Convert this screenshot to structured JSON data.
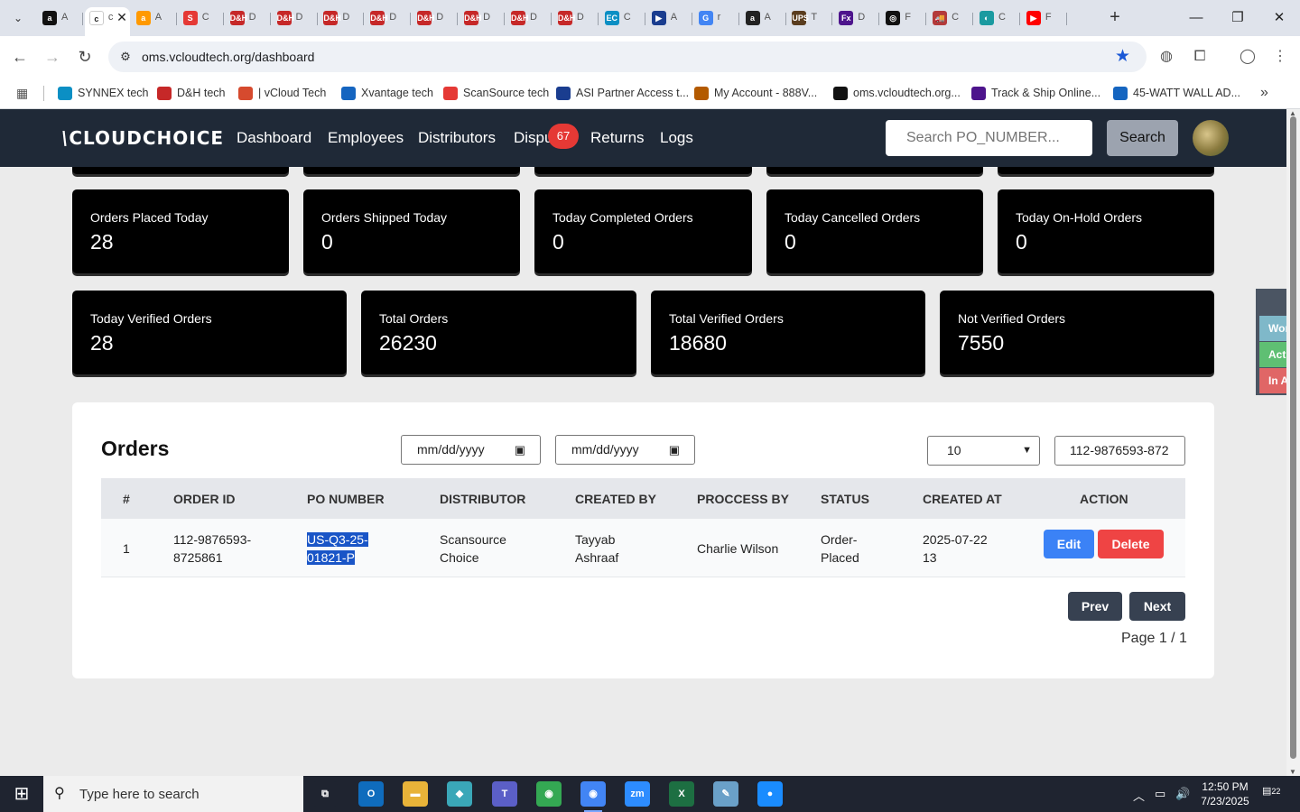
{
  "browser": {
    "tabs": [
      {
        "icon": "amazon-icon",
        "label": "A",
        "glyph": "a",
        "color": "#111111"
      },
      {
        "icon": "cloudchoice-icon",
        "label": "c",
        "glyph": "c",
        "color": "#ffffff",
        "active": true
      },
      {
        "icon": "amazon-icon",
        "label": "A",
        "glyph": "a",
        "color": "#ff9900"
      },
      {
        "icon": "scansource-icon",
        "label": "C",
        "glyph": "S",
        "color": "#e53935"
      },
      {
        "icon": "dh-icon",
        "label": "D",
        "glyph": "D&H",
        "color": "#c62828"
      },
      {
        "icon": "dh-icon",
        "label": "D",
        "glyph": "D&H",
        "color": "#c62828"
      },
      {
        "icon": "dh-icon",
        "label": "D",
        "glyph": "D&H",
        "color": "#c62828"
      },
      {
        "icon": "dh-icon",
        "label": "D",
        "glyph": "D&H",
        "color": "#c62828"
      },
      {
        "icon": "dh-icon",
        "label": "D",
        "glyph": "D&H",
        "color": "#c62828"
      },
      {
        "icon": "dh-icon",
        "label": "D",
        "glyph": "D&H",
        "color": "#c62828"
      },
      {
        "icon": "dh-icon",
        "label": "D",
        "glyph": "D&H",
        "color": "#c62828"
      },
      {
        "icon": "dh-icon",
        "label": "D",
        "glyph": "D&H",
        "color": "#c62828"
      },
      {
        "icon": "ec-icon",
        "label": "C",
        "glyph": "EC",
        "color": "#0b8fc4"
      },
      {
        "icon": "asi-icon",
        "label": "A",
        "glyph": "▶",
        "color": "#1a3d8f"
      },
      {
        "icon": "google-icon",
        "label": "r",
        "glyph": "G",
        "color": "#4285f4"
      },
      {
        "icon": "amazon-icon",
        "label": "A",
        "glyph": "a",
        "color": "#222222"
      },
      {
        "icon": "ups-icon",
        "label": "T",
        "glyph": "UPS",
        "color": "#5a3d1e"
      },
      {
        "icon": "fedex-icon",
        "label": "D",
        "glyph": "Fx",
        "color": "#4d148c"
      },
      {
        "icon": "openai-icon",
        "label": "F",
        "glyph": "◎",
        "color": "#111111"
      },
      {
        "icon": "truck-icon",
        "label": "C",
        "glyph": "🚚",
        "color": "#b33a3a"
      },
      {
        "icon": "edge-icon",
        "label": "C",
        "glyph": "◐",
        "color": "#1a9aa0"
      },
      {
        "icon": "youtube-icon",
        "label": "F",
        "glyph": "▶",
        "color": "#ff0000"
      }
    ],
    "url": "oms.vcloudtech.org/dashboard",
    "bookmarks": [
      {
        "icon": "ec-icon",
        "label": "SYNNEX tech",
        "color": "#0b8fc4"
      },
      {
        "icon": "dh-icon",
        "label": "D&H tech",
        "color": "#c62828"
      },
      {
        "icon": "vcloud-icon",
        "label": "| vCloud Tech",
        "color": "#d64a2e"
      },
      {
        "icon": "xvantage-icon",
        "label": "Xvantage tech",
        "color": "#1565c0"
      },
      {
        "icon": "scansource-icon",
        "label": "ScanSource tech",
        "color": "#e53935"
      },
      {
        "icon": "asi-icon",
        "label": "ASI Partner Access t...",
        "color": "#1a3d8f"
      },
      {
        "icon": "account-icon",
        "label": "My Account - 888V...",
        "color": "#b35a00"
      },
      {
        "icon": "oms-icon",
        "label": "oms.vcloudtech.org...",
        "color": "#111111"
      },
      {
        "icon": "fedex-icon",
        "label": "Track & Ship Online...",
        "color": "#4d148c"
      },
      {
        "icon": "charger-icon",
        "label": "45-WATT WALL AD...",
        "color": "#1565c0"
      }
    ]
  },
  "app": {
    "logo": "CLOUDCHOICE",
    "nav": [
      "Dashboard",
      "Employees",
      "Distributors",
      "Dispu",
      "Returns",
      "Logs"
    ],
    "disputes_badge": "67",
    "search_placeholder": "Search PO_NUMBER...",
    "search_button": "Search"
  },
  "stats_row1": [
    {
      "label": "Orders Placed Today",
      "value": "28"
    },
    {
      "label": "Orders Shipped Today",
      "value": "0"
    },
    {
      "label": "Today Completed Orders",
      "value": "0"
    },
    {
      "label": "Today Cancelled Orders",
      "value": "0"
    },
    {
      "label": "Today On-Hold Orders",
      "value": "0"
    }
  ],
  "stats_row2": [
    {
      "label": "Today Verified Orders",
      "value": "28"
    },
    {
      "label": "Total Orders",
      "value": "26230"
    },
    {
      "label": "Total Verified Orders",
      "value": "18680"
    },
    {
      "label": "Not Verified Orders",
      "value": "7550"
    }
  ],
  "side_panel": [
    {
      "label": "Working",
      "color": "#7fb8c9"
    },
    {
      "label": "Active",
      "color": "#5fbf73"
    },
    {
      "label": "In Active",
      "color": "#e06666"
    }
  ],
  "orders": {
    "title": "Orders",
    "date_from_placeholder": "mm/dd/yyyy",
    "date_to_placeholder": "mm/dd/yyyy",
    "page_size": "10",
    "filter_value": "112-9876593-872",
    "columns": [
      "#",
      "ORDER ID",
      "PO NUMBER",
      "DISTRIBUTOR",
      "CREATED BY",
      "PROCCESS BY",
      "STATUS",
      "CREATED AT",
      "ACTION"
    ],
    "rows": [
      {
        "num": "1",
        "order_id": "112-9876593-8725861",
        "po_number": "US-Q3-25-01821-P",
        "distributor": "Scansource Choice",
        "created_by": "Tayyab Ashraaf",
        "process_by": "Charlie Wilson",
        "status": "Order-Placed",
        "created_at": "2025-07-22 13"
      }
    ],
    "edit_label": "Edit",
    "delete_label": "Delete",
    "prev_label": "Prev",
    "next_label": "Next",
    "page_info": "Page 1 / 1"
  },
  "taskbar": {
    "search_placeholder": "Type here to search",
    "apps": [
      {
        "icon": "task-view-icon",
        "color": "#1f2430",
        "glyph": "⧉"
      },
      {
        "icon": "outlook-icon",
        "color": "#0f6cbd",
        "glyph": "O"
      },
      {
        "icon": "file-explorer-icon",
        "color": "#e8b339",
        "glyph": "▬"
      },
      {
        "icon": "app-diamond-icon",
        "color": "#3aa7b8",
        "glyph": "◆"
      },
      {
        "icon": "teams-icon",
        "color": "#5b5fc7",
        "glyph": "T"
      },
      {
        "icon": "chrome-icon",
        "color": "#34a853",
        "glyph": "◉"
      },
      {
        "icon": "chrome-profile-icon",
        "color": "#4285f4",
        "glyph": "◉",
        "active": true
      },
      {
        "icon": "zoom-icon",
        "color": "#2d8cff",
        "glyph": "zm"
      },
      {
        "icon": "excel-icon",
        "color": "#1d6f42",
        "glyph": "X"
      },
      {
        "icon": "notepad-icon",
        "color": "#6aa0c8",
        "glyph": "✎"
      },
      {
        "icon": "app-blue-icon",
        "color": "#1a8cff",
        "glyph": "●"
      }
    ],
    "time": "12:50 PM",
    "date": "7/23/2025",
    "notifications": "22"
  }
}
